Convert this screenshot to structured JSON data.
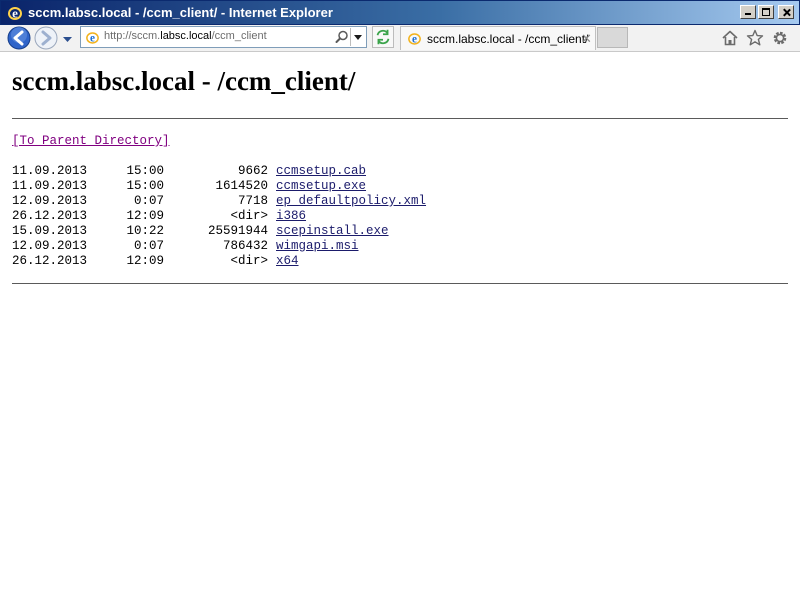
{
  "window": {
    "title": "sccm.labsc.local - /ccm_client/ - Internet Explorer"
  },
  "navbar": {
    "address": {
      "prefix": "http://sccm.",
      "host": "labsc.local",
      "path": "/ccm_client"
    },
    "tab_label": "sccm.labsc.local - /ccm_client/",
    "tab_close_glyph": "✕"
  },
  "page": {
    "title": "sccm.labsc.local - /ccm_client/",
    "parent_link": "[To Parent Directory]",
    "entries": [
      {
        "date": "11.09.2013",
        "time": "15:00",
        "size": "9662",
        "name": "ccmsetup.cab"
      },
      {
        "date": "11.09.2013",
        "time": "15:00",
        "size": "1614520",
        "name": "ccmsetup.exe"
      },
      {
        "date": "12.09.2013",
        "time": "0:07",
        "size": "7718",
        "name": "ep_defaultpolicy.xml"
      },
      {
        "date": "26.12.2013",
        "time": "12:09",
        "size": "<dir>",
        "name": "i386"
      },
      {
        "date": "15.09.2013",
        "time": "10:22",
        "size": "25591944",
        "name": "scepinstall.exe"
      },
      {
        "date": "12.09.2013",
        "time": "0:07",
        "size": "786432",
        "name": "wimgapi.msi"
      },
      {
        "date": "26.12.2013",
        "time": "12:09",
        "size": "<dir>",
        "name": "x64"
      }
    ]
  },
  "colors": {
    "visited_link": "#800080",
    "link": "#1b1b6b",
    "titlebar_start": "#0a246a",
    "titlebar_end": "#a6caf0"
  }
}
